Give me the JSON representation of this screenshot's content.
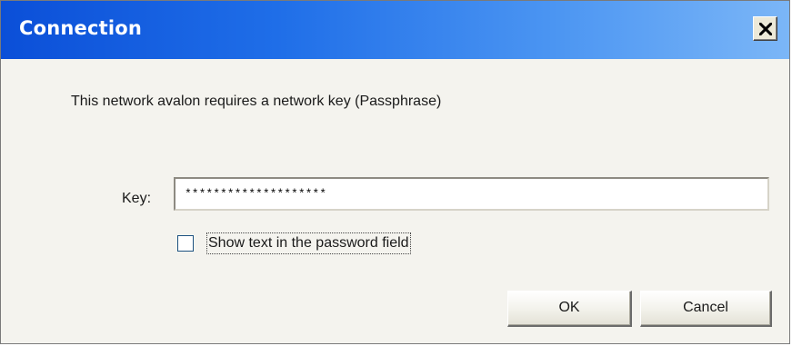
{
  "window": {
    "title": "Connection"
  },
  "dialog": {
    "message": "This network avalon requires a network key (Passphrase)",
    "key_label": "Key:",
    "key_value": "********************",
    "show_text_label": "Show text in the password field",
    "show_text_checked": false,
    "ok_label": "OK",
    "cancel_label": "Cancel"
  },
  "colors": {
    "titlebar_start": "#0b4fd8",
    "titlebar_end": "#7bb6f7",
    "dialog_background": "#f4f3ee"
  },
  "icons": {
    "close": "close-icon"
  }
}
